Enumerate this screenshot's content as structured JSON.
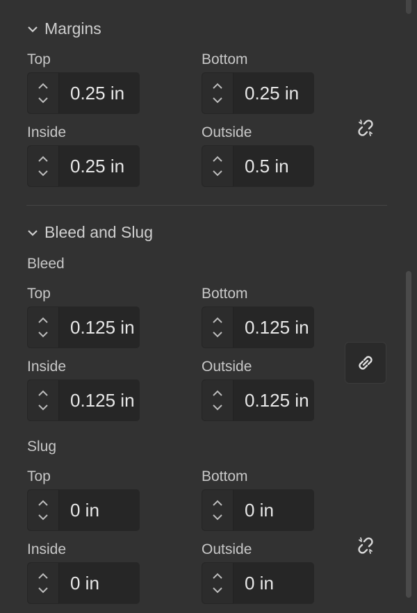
{
  "margins": {
    "title": "Margins",
    "top_label": "Top",
    "top_value": "0.25 in",
    "bottom_label": "Bottom",
    "bottom_value": "0.25 in",
    "inside_label": "Inside",
    "inside_value": "0.25 in",
    "outside_label": "Outside",
    "outside_value": "0.5 in",
    "link_state": "unlinked"
  },
  "bleed_slug": {
    "title": "Bleed and Slug",
    "bleed": {
      "label": "Bleed",
      "top_label": "Top",
      "top_value": "0.125 in",
      "bottom_label": "Bottom",
      "bottom_value": "0.125 in",
      "inside_label": "Inside",
      "inside_value": "0.125 in",
      "outside_label": "Outside",
      "outside_value": "0.125 in",
      "link_state": "linked"
    },
    "slug": {
      "label": "Slug",
      "top_label": "Top",
      "top_value": "0 in",
      "bottom_label": "Bottom",
      "bottom_value": "0 in",
      "inside_label": "Inside",
      "inside_value": "0 in",
      "outside_label": "Outside",
      "outside_value": "0 in",
      "link_state": "unlinked"
    }
  },
  "icons": {
    "collapse": "chevron-down-icon",
    "stepper_up": "chevron-up-icon",
    "stepper_down": "chevron-down-icon",
    "linked": "link-icon",
    "unlinked": "broken-link-icon"
  },
  "colors": {
    "panel_bg": "#323232",
    "field_bg": "#262626",
    "text": "#cfcfcf"
  }
}
